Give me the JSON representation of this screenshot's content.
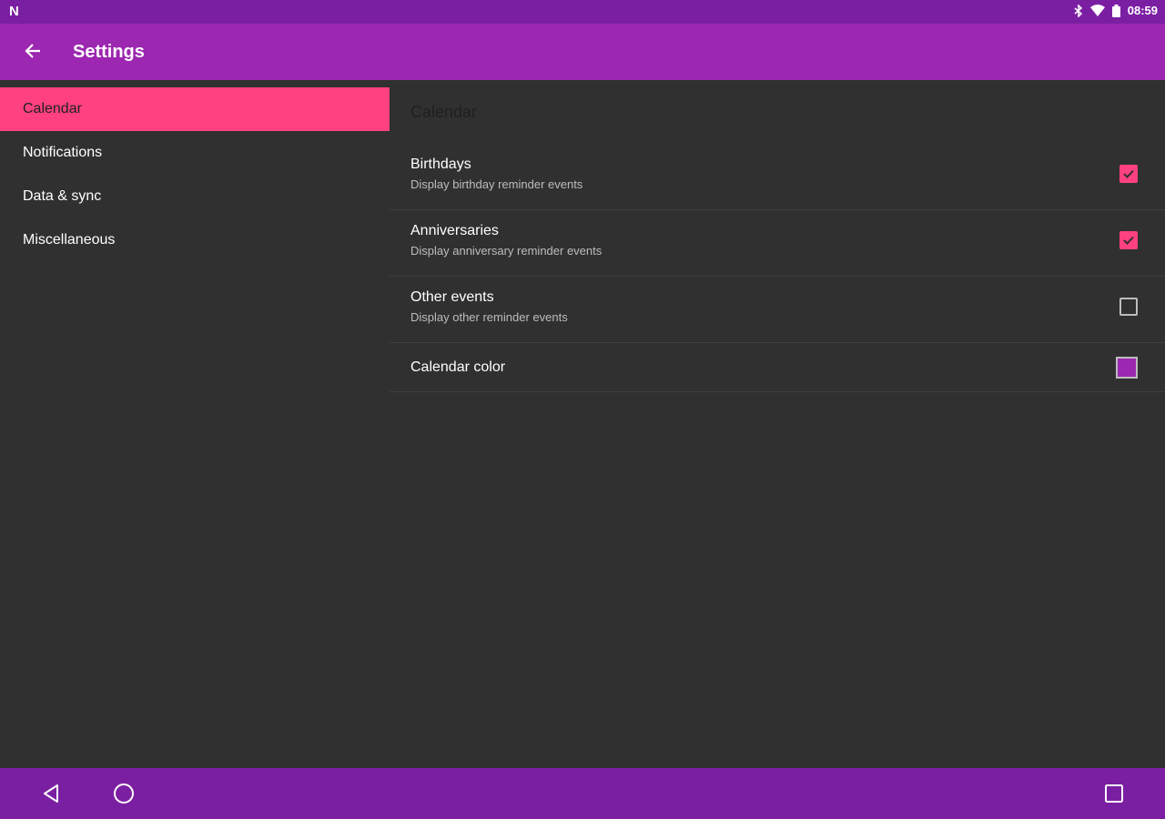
{
  "status_bar": {
    "notification_icon": "n-notification-icon",
    "time": "08:59",
    "icons": [
      "bluetooth-icon",
      "wifi-icon",
      "battery-icon"
    ]
  },
  "app_bar": {
    "title": "Settings",
    "back_icon": "arrow-back-icon"
  },
  "sidebar": {
    "items": [
      {
        "label": "Calendar",
        "selected": true
      },
      {
        "label": "Notifications",
        "selected": false
      },
      {
        "label": "Data & sync",
        "selected": false
      },
      {
        "label": "Miscellaneous",
        "selected": false
      }
    ]
  },
  "detail": {
    "section_title": "Calendar",
    "prefs": [
      {
        "title": "Birthdays",
        "summary": "Display birthday reminder events",
        "checked": true
      },
      {
        "title": "Anniversaries",
        "summary": "Display anniversary reminder events",
        "checked": true
      },
      {
        "title": "Other events",
        "summary": "Display other reminder events",
        "checked": false
      },
      {
        "title": "Calendar color",
        "color": "#9c27b0"
      }
    ]
  },
  "nav_bar": {
    "icons": [
      "back-triangle-icon",
      "home-circle-icon",
      "recents-square-icon"
    ]
  },
  "colors": {
    "status_bar": "#7b1fa2",
    "app_bar": "#9c27b0",
    "accent": "#ff4081",
    "background": "#303030"
  }
}
